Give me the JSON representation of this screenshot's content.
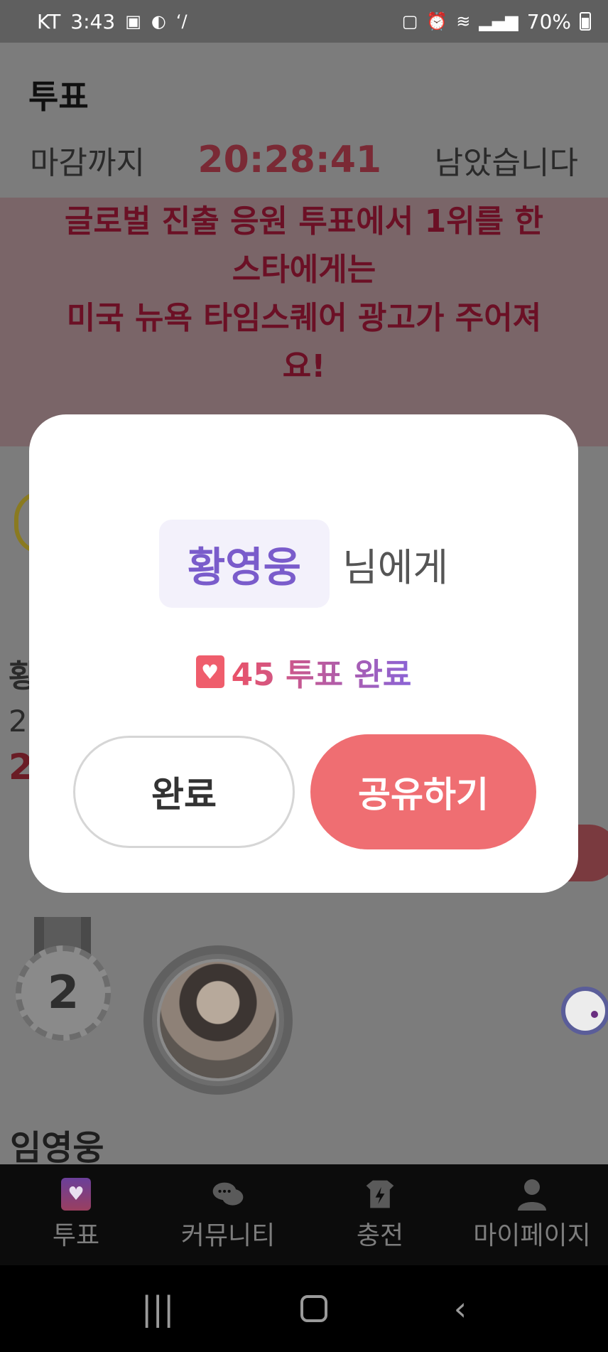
{
  "status_bar": {
    "carrier": "KT",
    "time": "3:43",
    "battery": "70%"
  },
  "header": {
    "title": "투표"
  },
  "deadline": {
    "label": "마감까지",
    "timer": "20:28:41",
    "suffix": "남았습니다"
  },
  "notice": {
    "line1": "글로벌 진출 응원 투표에서 1위를 한",
    "line2": "스타에게는",
    "line3": "미국 뉴욕 타임스퀘어 광고가 주어져",
    "line4": "요!"
  },
  "ranking": {
    "first_name_partial": "황",
    "first_sub_partial": "2",
    "first_votes_partial": "2",
    "second_rank": "2",
    "second_name": "임영웅"
  },
  "modal": {
    "recipient": "황영웅",
    "recipient_suffix": "님에게",
    "vote_result": "45 투표 완료",
    "done_button": "완료",
    "share_button": "공유하기"
  },
  "bottom_nav": {
    "items": [
      {
        "label": "투표",
        "icon": "vote-heart-icon"
      },
      {
        "label": "커뮤니티",
        "icon": "chat-bubbles-icon"
      },
      {
        "label": "충전",
        "icon": "charge-shop-icon"
      },
      {
        "label": "마이페이지",
        "icon": "person-icon"
      }
    ]
  },
  "colors": {
    "accent_pink": "#ef6e72",
    "recipient_purple": "#7a5ccb",
    "timer_red": "#7a2a35"
  }
}
